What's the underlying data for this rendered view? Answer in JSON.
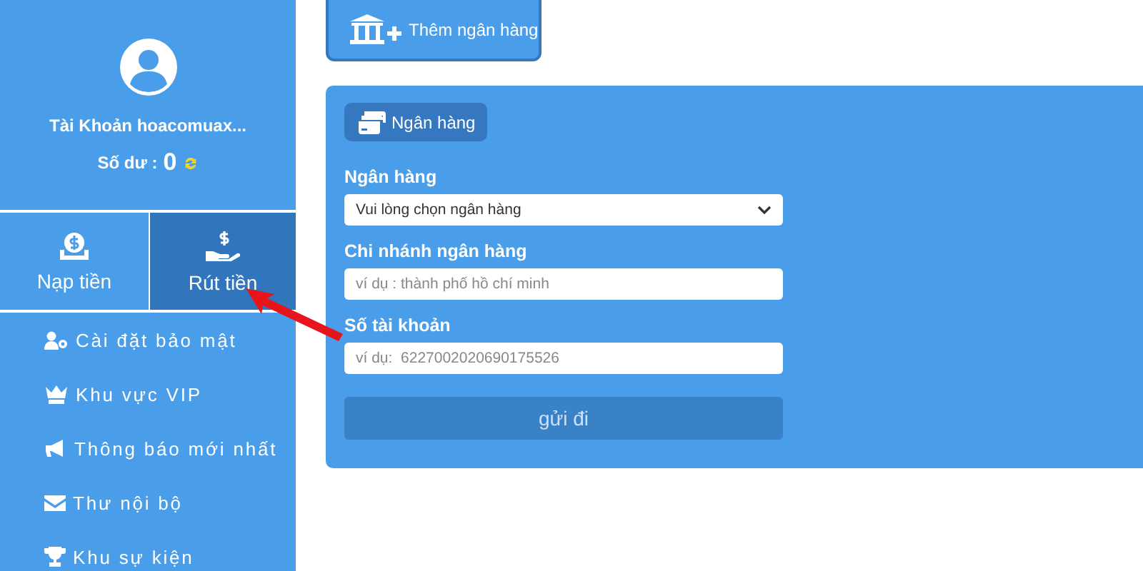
{
  "sidebar": {
    "account": "Tài Khoản hoacomuax...",
    "balance_label": "Số dư :",
    "balance": "0",
    "tiles": [
      {
        "label": "Nạp tiền",
        "selected": false
      },
      {
        "label": "Rút tiền",
        "selected": true
      }
    ],
    "menu": [
      {
        "label": "Cài đặt bảo mật"
      },
      {
        "label": "Khu vực VIP"
      },
      {
        "label": "Thông báo mới nhất"
      },
      {
        "label": "Thư nội bộ"
      },
      {
        "label": "Khu sự kiện"
      }
    ]
  },
  "add_bank_button": "Thêm ngân hàng",
  "panel": {
    "tab": "Ngân hàng",
    "fields": [
      {
        "kind": "select",
        "label": "Ngân hàng",
        "value": "Vui lòng chọn ngân hàng"
      },
      {
        "kind": "text",
        "label": "Chi nhánh ngân hàng",
        "placeholder": "ví dụ : thành phố hồ chí minh"
      },
      {
        "kind": "text",
        "label": "Số tài khoản",
        "placeholder": "ví dụ:  6227002020690175526"
      }
    ],
    "submit": "gửi đi"
  }
}
